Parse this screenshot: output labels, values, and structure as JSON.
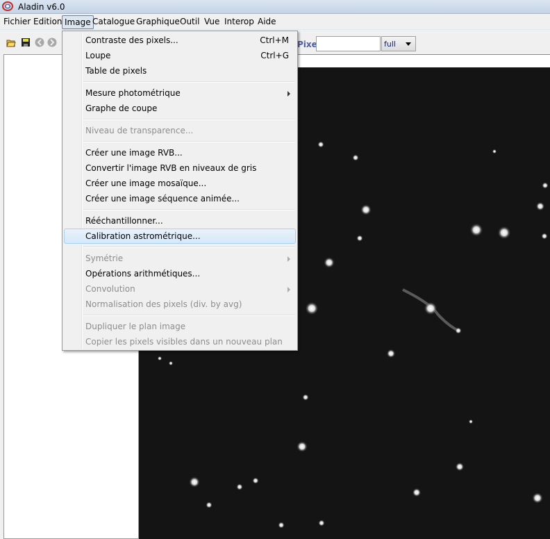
{
  "window": {
    "title": "Aladin v6.0"
  },
  "menubar": [
    "Fichier",
    "Edition",
    "Image",
    "Catalogue",
    "Graphique",
    "Outil",
    "Vue",
    "Interop",
    "Aide"
  ],
  "menubar_open": "Image",
  "toolbar": {
    "icons": [
      "open-folder-icon",
      "save-icon",
      "back-icon",
      "forward-icon"
    ],
    "pixel_label": "Pixel",
    "pixel_value": "",
    "mode_select": "full"
  },
  "image_menu": [
    {
      "label": "Contraste des pixels...",
      "shortcut": "Ctrl+M"
    },
    {
      "label": "Loupe",
      "shortcut": "Ctrl+G"
    },
    {
      "label": "Table de pixels"
    },
    {
      "sep": true
    },
    {
      "label": "Mesure photométrique",
      "submenu": true
    },
    {
      "label": "Graphe de coupe"
    },
    {
      "sep": true
    },
    {
      "label": "Niveau de transparence...",
      "disabled": true
    },
    {
      "sep": true
    },
    {
      "label": "Créer une image RVB..."
    },
    {
      "label": "Convertir l'image RVB en niveaux de gris"
    },
    {
      "label": "Créer une image mosaïque..."
    },
    {
      "label": "Créer une image séquence animée..."
    },
    {
      "sep": true
    },
    {
      "label": "Rééchantillonner..."
    },
    {
      "label": "Calibration astrométrique...",
      "highlighted": true
    },
    {
      "sep": true
    },
    {
      "label": "Symétrie",
      "disabled": true,
      "submenu": true
    },
    {
      "label": "Opérations arithmétiques..."
    },
    {
      "label": "Convolution",
      "disabled": true,
      "submenu": true
    },
    {
      "label": "Normalisation des pixels (div. by avg)",
      "disabled": true
    },
    {
      "sep": true
    },
    {
      "label": "Dupliquer le plan image",
      "disabled": true
    },
    {
      "label": "Copier les pixels visibles dans un nouveau plan",
      "disabled": true
    }
  ]
}
